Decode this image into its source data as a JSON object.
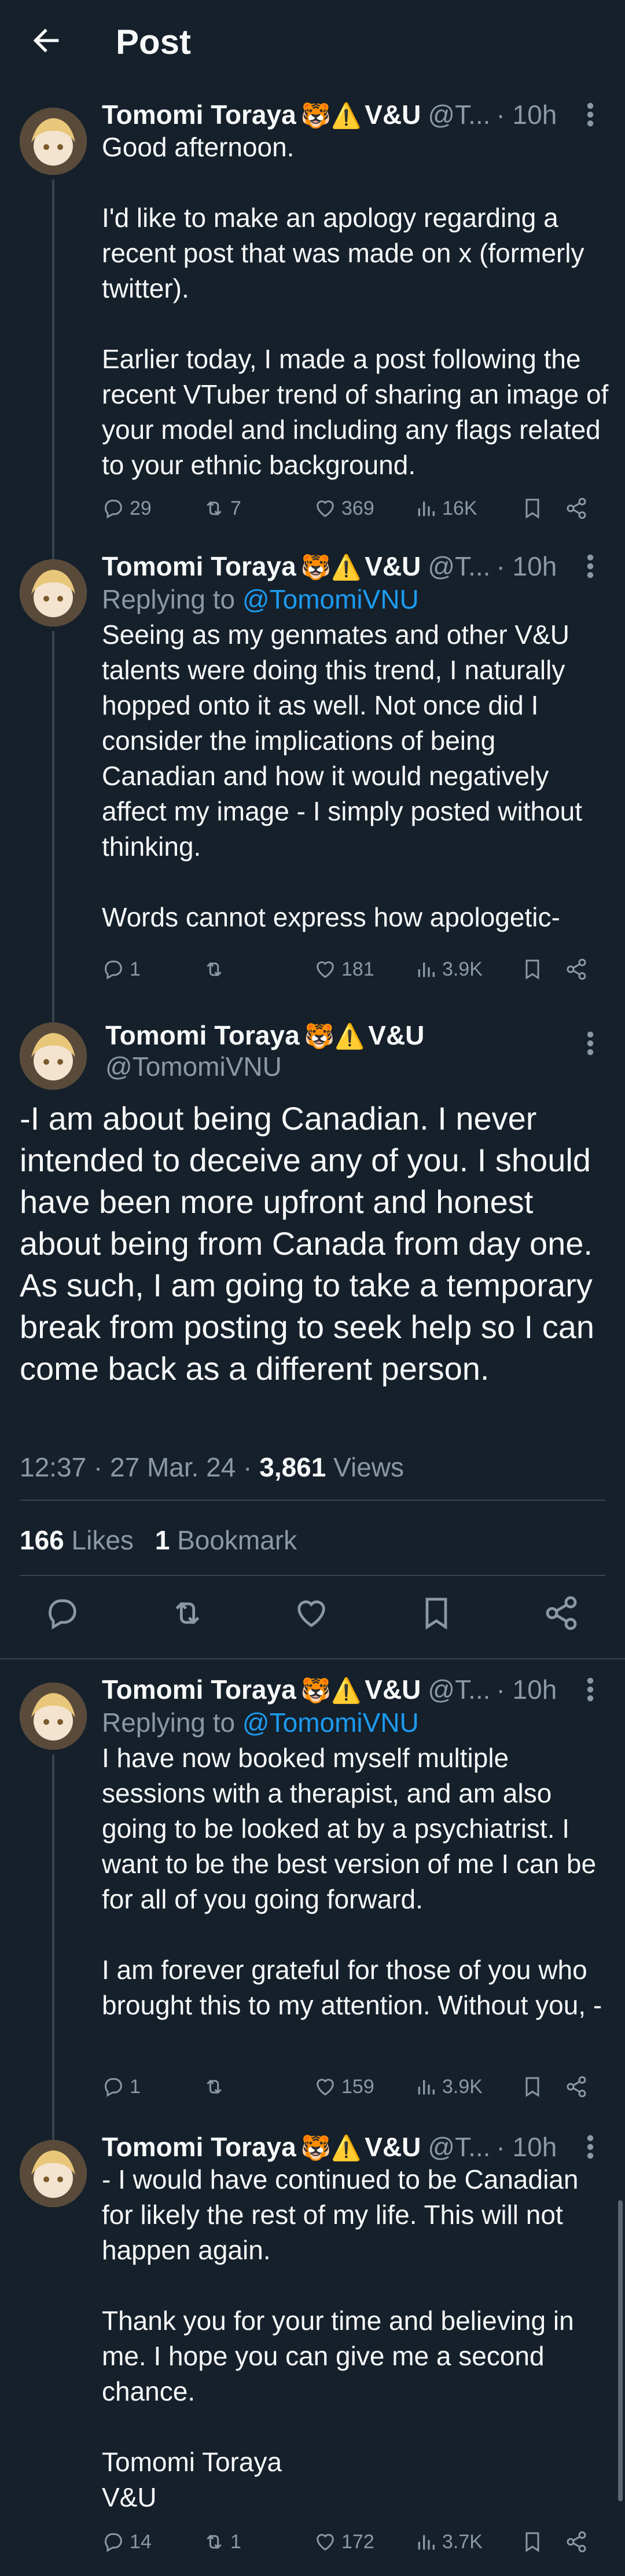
{
  "header": {
    "title": "Post"
  },
  "author": {
    "name": "Tomomi Toraya",
    "badges": "🐯⚠️",
    "org": "V&U",
    "handle_short": "@T...",
    "handle": "@TomomiVNU"
  },
  "posts": [
    {
      "time": "· 10h",
      "reply_to": "",
      "paragraphs": [
        "Good afternoon.",
        "I'd like to make an apology regarding a recent post that was made on x (formerly twitter).",
        "Earlier today, I made a post following the recent VTuber trend of sharing an image of your model and including any flags related to your ethnic background."
      ],
      "stats": {
        "replies": "29",
        "reposts": "7",
        "likes": "369",
        "views": "16K"
      }
    },
    {
      "time": "· 10h",
      "reply_to_prefix": "Replying to",
      "reply_to": "@TomomiVNU",
      "paragraphs": [
        "Seeing as my genmates and other V&U talents were doing this trend, I naturally hopped onto it as well. Not once did I consider the implications of being Canadian and how it would negatively affect my image - I simply posted without thinking.",
        "Words cannot express how apologetic-"
      ],
      "stats": {
        "replies": "1",
        "reposts": "",
        "likes": "181",
        "views": "3.9K"
      }
    }
  ],
  "focal": {
    "text": "-I am about being Canadian. I never intended to deceive any of you. I should have been more upfront and honest about being from Canada from day one. As such, I am going to take a temporary break from posting to seek help so I can come back as a different person.",
    "timestamp": "12:37 · 27 Mar. 24 · ",
    "views_count": "3,861",
    "views_label": " Views",
    "likes_count": "166",
    "likes_label": " Likes",
    "bookmarks_count": "1",
    "bookmarks_label": " Bookmark"
  },
  "replies": [
    {
      "time": "· 10h",
      "reply_to_prefix": "Replying to",
      "reply_to": "@TomomiVNU",
      "paragraphs": [
        "I have now booked myself multiple sessions with a therapist, and am also going to be looked at by a psychiatrist. I want to be the best version of me I can be for all of you going forward.",
        "I am forever grateful for those of you who brought this to my attention. Without you, -"
      ],
      "stats": {
        "replies": "1",
        "reposts": "",
        "likes": "159",
        "views": "3.9K"
      }
    },
    {
      "time": "· 10h",
      "paragraphs": [
        "- I would have continued to be Canadian for likely the rest of my life. This will not happen again.",
        "Thank you for your time and believing in me. I hope you can give me a second chance.",
        "Tomomi Toraya\nV&U"
      ],
      "stats": {
        "replies": "14",
        "reposts": "1",
        "likes": "172",
        "views": "3.7K"
      }
    }
  ],
  "colors": {
    "background": "#15202b",
    "accent": "#1d9bf0",
    "muted": "#8b98a5",
    "divider": "#38444d"
  }
}
